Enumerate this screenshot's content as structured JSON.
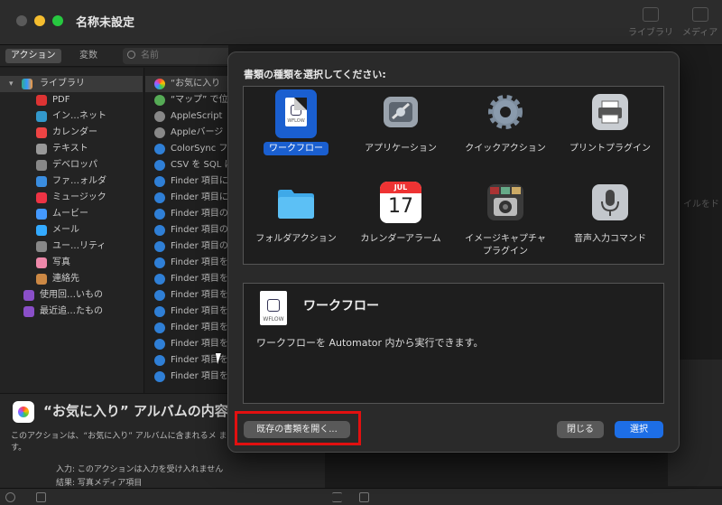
{
  "window": {
    "title": "名称未設定"
  },
  "toolbar": {
    "library_label": "ライブラリ",
    "media_label": "メディア"
  },
  "left_tools": {
    "actions_tab": "アクション",
    "variables_tab": "変数",
    "search_placeholder": "名前"
  },
  "library": {
    "header": "ライブラリ",
    "items": [
      "PDF",
      "イン…ネット",
      "カレンダー",
      "テキスト",
      "デベロッパ",
      "ファ…ォルダ",
      "ミュージック",
      "ムービー",
      "メール",
      "ユー…リティ",
      "写真",
      "連絡先"
    ],
    "folders": [
      "使用回…いもの",
      "最近追…たもの"
    ]
  },
  "actions": {
    "items": [
      "“お気に入り",
      "“マップ” で位",
      "AppleScript",
      "Appleバージ",
      "ColorSync フ",
      "CSV を SQL に",
      "Finder 項目に",
      "Finder 項目に",
      "Finder 項目の",
      "Finder 項目の",
      "Finder 項目の",
      "Finder 項目を",
      "Finder 項目を",
      "Finder 項目を",
      "Finder 項目を",
      "Finder 項目を",
      "Finder 項目を",
      "Finder 項目を",
      "Finder 項目を"
    ]
  },
  "workarea": {
    "drop_hint": "イルをド"
  },
  "description": {
    "title": "“お気に入り” アルバムの内容",
    "body": "このアクションは、“お気に入り” アルバムに含まれるメ ます。",
    "input_label": "入力:",
    "input_value": "このアクションは入力を受け入れません",
    "result_label": "結果:",
    "result_value": "写真メディア項目"
  },
  "sheet": {
    "prompt": "書類の種類を選択してください:",
    "types": [
      {
        "name": "ワークフロー",
        "icon": "workflow-icon",
        "selected": true
      },
      {
        "name": "アプリケーション",
        "icon": "application-icon",
        "selected": false
      },
      {
        "name": "クイックアクション",
        "icon": "gear-icon",
        "selected": false
      },
      {
        "name": "プリントプラグイン",
        "icon": "printer-icon",
        "selected": false
      },
      {
        "name": "フォルダアクション",
        "icon": "folder-icon",
        "selected": false
      },
      {
        "name": "カレンダーアラーム",
        "icon": "calendar-icon",
        "selected": false
      },
      {
        "name": "イメージキャプチャ プラグイン",
        "icon": "camera-icon",
        "selected": false
      },
      {
        "name": "音声入力コマンド",
        "icon": "microphone-icon",
        "selected": false
      }
    ],
    "calendar_month": "JUL",
    "calendar_day": "17",
    "file_tag": "WFLOW",
    "details": {
      "title": "ワークフロー",
      "description": "ワークフローを Automator 内から実行できます。"
    },
    "open_existing_button": "既存の書類を開く...",
    "close_button": "閉じる",
    "choose_button": "選択"
  },
  "colors": {
    "accent": "#1d6ee6",
    "highlight": "#e21010",
    "sheet_bg": "#2a2a2a"
  }
}
